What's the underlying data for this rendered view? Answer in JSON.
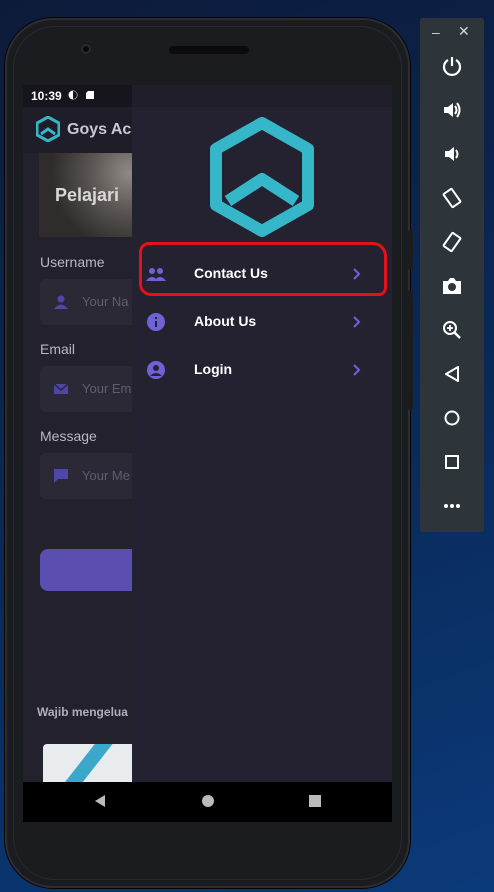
{
  "statusbar": {
    "time": "10:39"
  },
  "background_app": {
    "title": "Goys Aca",
    "banner_text": "Pelajari",
    "username_label": "Username",
    "username_placeholder": "Your Na",
    "email_label": "Email",
    "email_placeholder": "Your Em",
    "message_label": "Message",
    "message_placeholder": "Your Me",
    "footer_text": "Wajib mengelua"
  },
  "drawer": {
    "items": [
      {
        "label": "Contact Us",
        "icon": "people-icon"
      },
      {
        "label": "About Us",
        "icon": "info-icon"
      },
      {
        "label": "Login",
        "icon": "account-circle-icon"
      }
    ]
  },
  "colors": {
    "accent": "#6f62d6",
    "logo": "#35b6c9",
    "drawer_bg": "#242230",
    "highlight": "#e3111b"
  },
  "toolbar": {
    "buttons": [
      "power-icon",
      "volume-up-icon",
      "volume-down-icon",
      "rotate-left-icon",
      "rotate-right-icon",
      "camera-icon",
      "zoom-in-icon",
      "back-icon",
      "home-icon",
      "overview-icon",
      "more-icon"
    ]
  }
}
